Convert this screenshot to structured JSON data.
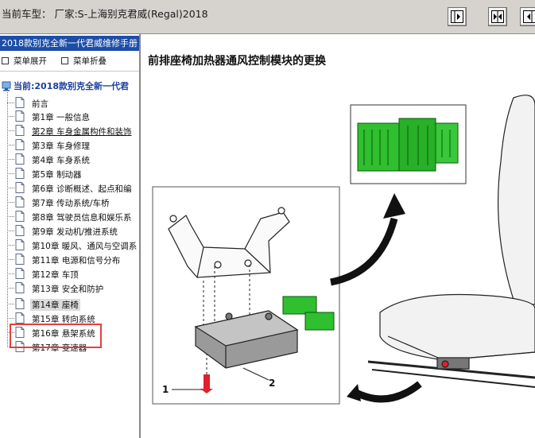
{
  "window": {
    "title": "当前车型： 厂家:S-上海别克君威(Regal)2018"
  },
  "toolbar": {
    "buttons": [
      {
        "icon": "collapse-left-icon"
      },
      {
        "icon": "split-view-icon"
      },
      {
        "icon": "expand-right-icon"
      }
    ]
  },
  "sidebar": {
    "manual_title": "2018款别克全新一代君威维修手册",
    "expand_all": "菜单展开",
    "collapse_all": "菜单折叠",
    "current_root": "当前:2018款别克全新一代君",
    "items": [
      {
        "label": "前言"
      },
      {
        "label": "第1章 一般信息"
      },
      {
        "label": "第2章 车身金属构件和装饰"
      },
      {
        "label": "第3章 车身修理"
      },
      {
        "label": "第4章 车身系统"
      },
      {
        "label": "第5章 制动器"
      },
      {
        "label": "第6章 诊断概述、起点和编"
      },
      {
        "label": "第7章 传动系统/车桥"
      },
      {
        "label": "第8章 驾驶员信息和娱乐系"
      },
      {
        "label": "第9章 发动机/推进系统"
      },
      {
        "label": "第10章 暖风、通风与空调系"
      },
      {
        "label": "第11章 电源和信号分布"
      },
      {
        "label": "第12章 车顶"
      },
      {
        "label": "第13章 安全和防护"
      },
      {
        "label": "第14章 座椅"
      },
      {
        "label": "第15章 转向系统"
      },
      {
        "label": "第16章 悬架系统"
      },
      {
        "label": "第17章 变速器"
      }
    ],
    "highlight_color": "#e04040"
  },
  "content": {
    "title": "前排座椅加热器通风控制模块的更换",
    "callouts": {
      "bolt": "1",
      "module": "2"
    },
    "accent_color": "#22b022"
  }
}
